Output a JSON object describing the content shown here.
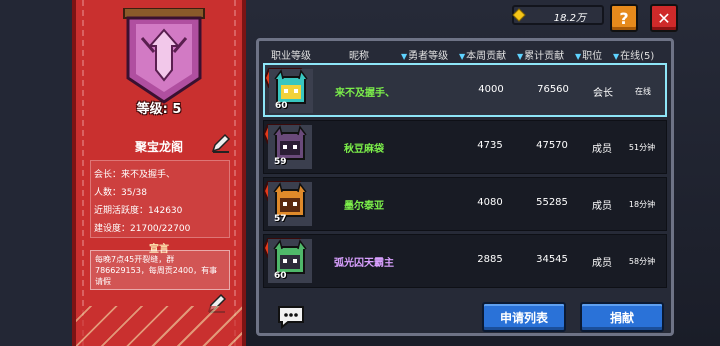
{
  "topbar": {
    "currency_value": "18.2万",
    "help_label": "?",
    "close_label": "✕"
  },
  "guild": {
    "level_text": "等级: 5",
    "name": "聚宝龙阁",
    "info": [
      {
        "label": "会长：",
        "value": "来不及握手、"
      },
      {
        "label": "人数：",
        "value": "35/38"
      },
      {
        "label": "近期活跃度：",
        "value": "142630"
      },
      {
        "label": "建设度：",
        "value": "21700/22700"
      }
    ],
    "notice_title": "宣言",
    "notice_text": "每晚7点45开裂缝，群786629153，每周贡2400，有事请假"
  },
  "table": {
    "headers": [
      {
        "label": "职业等级",
        "sort": false
      },
      {
        "label": "昵称",
        "sort": false
      },
      {
        "label": "勇者等级",
        "sort": true
      },
      {
        "label": "本周贡献",
        "sort": true
      },
      {
        "label": "累计贡献",
        "sort": true
      },
      {
        "label": "职位",
        "sort": true
      },
      {
        "label": "在线(5)",
        "sort": true
      }
    ],
    "rows": [
      {
        "level": "60",
        "name": "来不及握手、",
        "name_color": "#7cf04a",
        "rank": "EX1",
        "week": "4000",
        "total": "76560",
        "position": "会长",
        "online": "在线",
        "self": true,
        "avatar": "cyan-crown"
      },
      {
        "level": "59",
        "name": "秋豆麻袋",
        "name_color": "#7cf04a",
        "rank": "EX1",
        "week": "4735",
        "total": "47570",
        "position": "成员",
        "online": "51分钟",
        "self": false,
        "avatar": "purple-horns"
      },
      {
        "level": "57",
        "name": "墨尔泰亚",
        "name_color": "#7cf04a",
        "rank": "EX1",
        "week": "4080",
        "total": "55285",
        "position": "成员",
        "online": "18分钟",
        "self": false,
        "avatar": "orange-horns"
      },
      {
        "level": "60",
        "name": "弧光囚天霸主",
        "name_color": "#d9a0ff",
        "rank": "EX1",
        "week": "2885",
        "total": "34545",
        "position": "成员",
        "online": "58分钟",
        "self": false,
        "avatar": "green-robot"
      }
    ]
  },
  "buttons": {
    "apply_list": "申请列表",
    "donate": "捐献"
  },
  "colors": {
    "banner": "#c9302f",
    "button_blue": "#2a72d8",
    "highlight_row": "#8ee6f8"
  }
}
